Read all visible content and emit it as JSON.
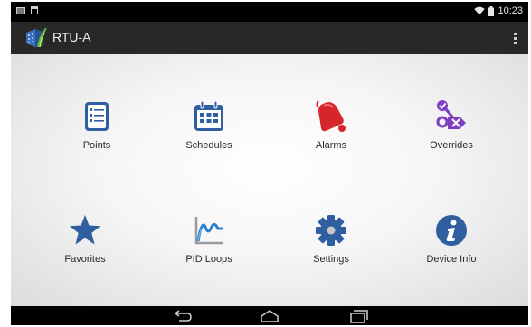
{
  "status_bar": {
    "time": "10:23",
    "left_icons": [
      "image-notification-icon",
      "calendar-notification-icon"
    ],
    "right_icons": [
      "wifi-icon",
      "battery-icon"
    ]
  },
  "action_bar": {
    "title": "RTU-A",
    "logo_icon": "rtu-building-logo-icon",
    "menu_icon": "overflow-menu-icon",
    "background": "#282828"
  },
  "menu": {
    "items": [
      {
        "label": "Points",
        "icon": "points-list-icon"
      },
      {
        "label": "Schedules",
        "icon": "schedules-calendar-icon"
      },
      {
        "label": "Alarms",
        "icon": "alarm-bell-icon"
      },
      {
        "label": "Overrides",
        "icon": "overrides-icon"
      },
      {
        "label": "Favorites",
        "icon": "favorites-star-icon"
      },
      {
        "label": "PID Loops",
        "icon": "pid-loops-graph-icon"
      },
      {
        "label": "Settings",
        "icon": "settings-gear-icon"
      },
      {
        "label": "Device Info",
        "icon": "device-info-icon"
      }
    ]
  },
  "nav_bar": {
    "buttons": [
      "back-icon",
      "home-icon",
      "recent-apps-icon"
    ]
  },
  "colors": {
    "icon_blue": "#2f5fa0",
    "alarm_red": "#d6262c",
    "overrides_purple": "#7b3fbf"
  }
}
